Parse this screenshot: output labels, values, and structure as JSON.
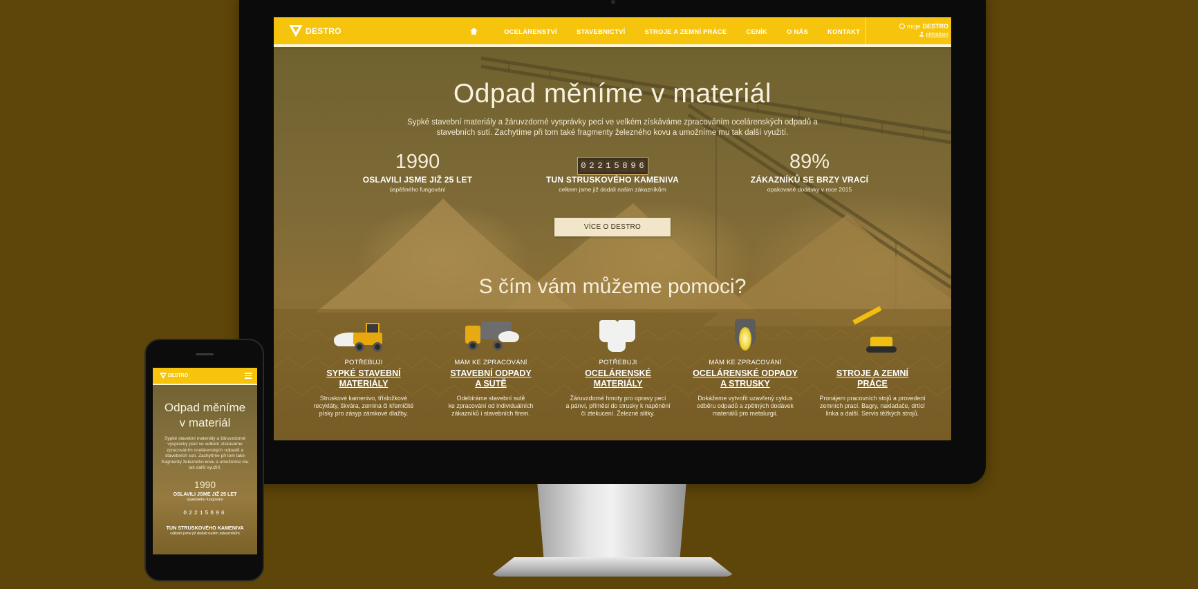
{
  "desktop": {
    "nav": {
      "logo": "DESTRO",
      "items": [
        "OCELÁRENSTVÍ",
        "STAVEBNICTVÍ",
        "STROJE A ZEMNÍ PRÁCE",
        "CENÍK",
        "O NÁS",
        "KONTAKT"
      ],
      "moje_prefix": "moje",
      "moje_brand": "DESTRO",
      "login": "přihlášení"
    },
    "hero": {
      "title": "Odpad měníme v materiál",
      "subtitle": "Sypké stavební materiály a žáruvzdorné vysprávky pecí ve velkém získáváme zpracováním ocelárenských odpadů a stavebních sutí. Zachytíme při tom také fragmenty železného kovu a umožníme mu tak další využití.",
      "stats": [
        {
          "value": "1990",
          "label": "OSLAVILI JSME JIŽ 25 LET",
          "desc": "úspěšného fungování"
        },
        {
          "value": "02215896",
          "label": "TUN STRUSKOVÉHO KAMENIVA",
          "desc": "celkem jsme již dodali našim zákazníkům"
        },
        {
          "value": "89%",
          "label": "ZÁKAZNÍKŮ SE BRZY VRACÍ",
          "desc": "opakované dodávky v roce 2015"
        }
      ],
      "cta": "VÍCE O DESTRO"
    },
    "help": {
      "title": "S čím vám můžeme pomoci?",
      "services": [
        {
          "pre": "POTŘEBUJI",
          "name_1": "SYPKÉ STAVEBNÍ",
          "name_2": "MATERIÁLY",
          "text_1": "Struskové kamenivo, třísložkové",
          "text_2": "recykláty, škvára, zemina či křemičité",
          "text_3": "písky pro zásyp zámkové dlažby."
        },
        {
          "pre": "MÁM KE ZPRACOVÁNÍ",
          "name_1": "STAVEBNÍ ODPADY",
          "name_2": "A SUTĚ",
          "text_1": "Odebíráme stavební sutě",
          "text_2": "ke zpracování od individuálních",
          "text_3": "zákazníků i stavebních firem."
        },
        {
          "pre": "POTŘEBUJI",
          "name_1": "OCELÁRENSKÉ",
          "name_2": "MATERIÁLY",
          "text_1": "Žáruvzdorné hmoty pro opravy pecí",
          "text_2": "a pánví, příměsi do strusky k napěnění",
          "text_3": "či ztekucení. Železné slitky."
        },
        {
          "pre": "MÁM KE ZPRACOVÁNÍ",
          "name_1": "OCELÁRENSKÉ ODPADY",
          "name_2": "A STRUSKY",
          "text_1": "Dokážeme vytvořit uzavřený cyklus",
          "text_2": "odběru odpadů a zpětných dodávek",
          "text_3": "materiálů pro metalurgii."
        },
        {
          "pre": "",
          "name_1": "STROJE A ZEMNÍ",
          "name_2": "PRÁCE",
          "text_1": "Pronájem pracovních stojů a provedení",
          "text_2": "zemních prací. Bagry, nakladače, drtící",
          "text_3": "linka a další. Servis těžkých strojů."
        }
      ]
    }
  },
  "mobile": {
    "logo": "DESTRO",
    "title_1": "Odpad měníme",
    "title_2": "v materiál",
    "subtitle": "Sypké stavební materiály a žáruvzdorné vysprávky pecí ve velkém získáváme zpracováním ocelárenských odpadů a stavebních sutí. Zachytíme při tom také fragmenty železného kovu a umožníme mu tak další využití.",
    "stat1": {
      "value": "1990",
      "label": "OSLAVILI JSME JIŽ 25 LET",
      "desc": "úspěšného fungování"
    },
    "stat2": {
      "value": "02215896",
      "label": "TUN STRUSKOVÉHO KAMENIVA",
      "desc": "celkem jsme již dodali našim zákazníkům"
    }
  },
  "colors": {
    "brand_yellow": "#f6c40c",
    "background": "#5e4509"
  }
}
